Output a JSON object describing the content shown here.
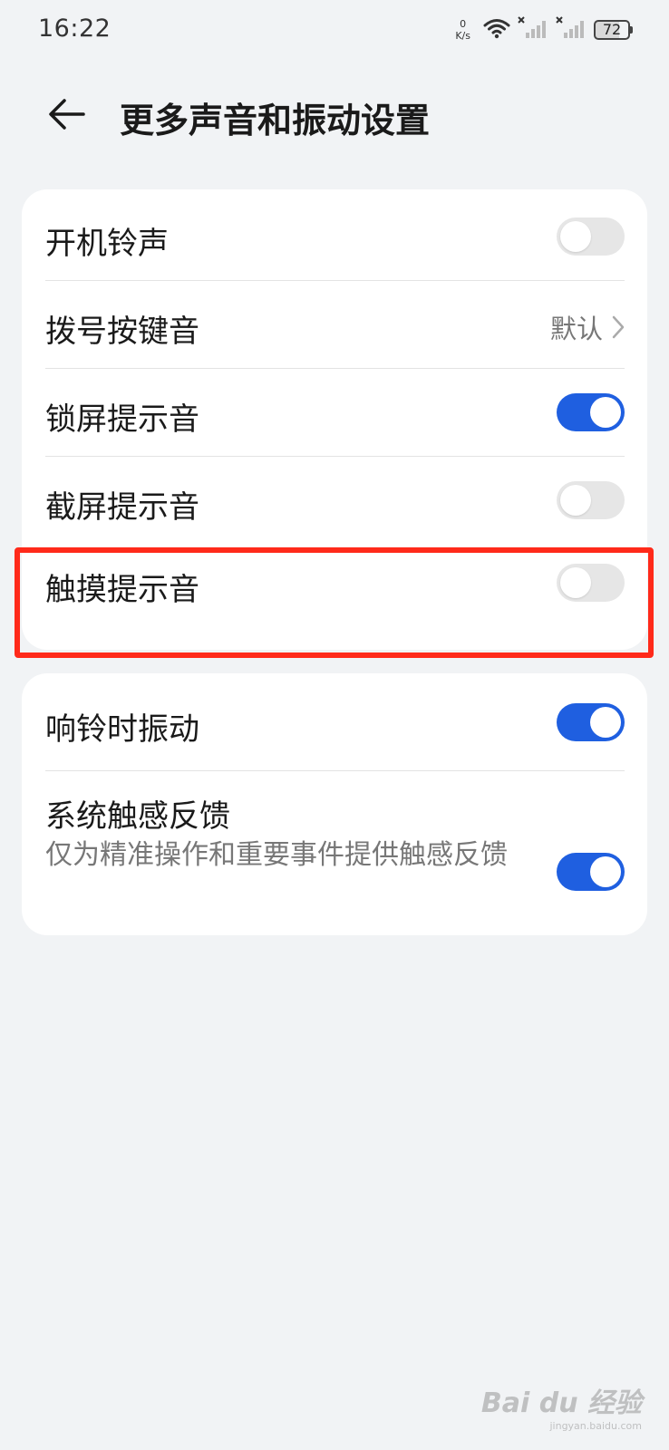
{
  "status_bar": {
    "time": "16:22",
    "net_speed_value": "0",
    "net_speed_unit": "K/s",
    "battery": "72"
  },
  "header": {
    "title": "更多声音和振动设置"
  },
  "card1": {
    "rows": [
      {
        "label": "开机铃声",
        "control": "toggle",
        "state": "off"
      },
      {
        "label": "拨号按键音",
        "control": "value",
        "value": "默认"
      },
      {
        "label": "锁屏提示音",
        "control": "toggle",
        "state": "on"
      },
      {
        "label": "截屏提示音",
        "control": "toggle",
        "state": "off"
      },
      {
        "label": "触摸提示音",
        "control": "toggle",
        "state": "off"
      }
    ]
  },
  "card2": {
    "rows": [
      {
        "label": "响铃时振动",
        "control": "toggle",
        "state": "on"
      },
      {
        "label": "系统触感反馈",
        "subtitle": "仅为精准操作和重要事件提供触感反馈",
        "control": "toggle",
        "state": "on"
      }
    ]
  },
  "watermark": {
    "logo": "Bai du 经验",
    "url": "jingyan.baidu.com"
  },
  "colors": {
    "accent": "#1f5fe0",
    "highlight": "#ff2a1a",
    "background": "#f1f3f5"
  }
}
